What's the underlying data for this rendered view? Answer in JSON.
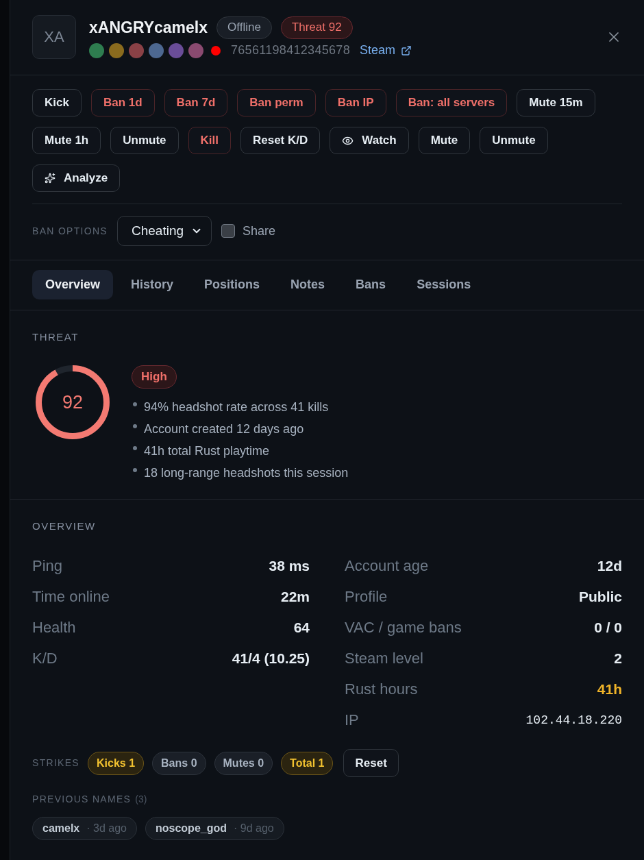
{
  "header": {
    "initials": "XA",
    "name": "xANGRYcamelx",
    "status": "Offline",
    "threat_badge": "Threat 92",
    "tags": [
      {
        "kind": "swatch",
        "color": "#2e7d4f"
      },
      {
        "kind": "swatch",
        "color": "#8a6b1e"
      },
      {
        "kind": "swatch",
        "color": "#8a4146"
      },
      {
        "kind": "swatch",
        "color": "#4d6891"
      },
      {
        "kind": "swatch",
        "color": "#6a4d98"
      },
      {
        "kind": "swatch",
        "color": "#8a4a70"
      },
      {
        "kind": "dot",
        "color": "#ff0000"
      }
    ],
    "steam_id": "76561198412345678",
    "profile_link": "Steam"
  },
  "actions": [
    {
      "label": "Kick",
      "kind": "neutral"
    },
    {
      "label": "Ban 1d",
      "kind": "danger"
    },
    {
      "label": "Ban 7d",
      "kind": "danger"
    },
    {
      "label": "Ban perm",
      "kind": "danger"
    },
    {
      "label": "Ban IP",
      "kind": "danger"
    },
    {
      "label": "Ban: all servers",
      "kind": "danger"
    },
    {
      "label": "Mute 15m",
      "kind": "neutral"
    },
    {
      "label": "Mute 1h",
      "kind": "neutral"
    },
    {
      "label": "Unmute",
      "kind": "neutral"
    },
    {
      "label": "Kill",
      "kind": "danger"
    },
    {
      "label": "Reset K/D",
      "kind": "neutral"
    },
    {
      "label": "Watch",
      "kind": "watch"
    },
    {
      "label": "Mute",
      "kind": "neutral"
    },
    {
      "label": "Unmute",
      "kind": "neutral"
    },
    {
      "label": "Analyze",
      "kind": "analyze"
    }
  ],
  "ban_options": {
    "label": "BAN OPTIONS",
    "reason": "Cheating",
    "share": {
      "label": "Share",
      "checked": false
    }
  },
  "tabs": [
    {
      "label": "Overview",
      "selected": true
    },
    {
      "label": "History",
      "selected": false
    },
    {
      "label": "Positions",
      "selected": false
    },
    {
      "label": "Notes",
      "selected": false
    },
    {
      "label": "Bans",
      "selected": false
    },
    {
      "label": "Sessions",
      "selected": false
    }
  ],
  "threat": {
    "title": "THREAT",
    "score": "92",
    "level": 0.92,
    "rating": "High",
    "reasons": [
      "94% headshot rate across 41 kills",
      "Account created 12 days ago",
      "41h total Rust playtime",
      "18 long-range headshots this session"
    ]
  },
  "overview": {
    "title": "OVERVIEW",
    "left": [
      {
        "label": "Ping",
        "value": "38 ms",
        "kind": "plain"
      },
      {
        "label": "Time online",
        "value": "22m",
        "kind": "plain"
      },
      {
        "label": "Health",
        "value": "64",
        "kind": "plain"
      },
      {
        "label": "K/D",
        "value": "41/4 (10.25)",
        "kind": "plain"
      }
    ],
    "right": [
      {
        "label": "Account age",
        "value": "12d",
        "kind": "plain"
      },
      {
        "label": "Profile",
        "value": "Public",
        "kind": "plain"
      },
      {
        "label": "VAC / game bans",
        "value": "0 / 0",
        "kind": "plain"
      },
      {
        "label": "Steam level",
        "value": "2",
        "kind": "plain"
      },
      {
        "label": "Rust hours",
        "value": "41h",
        "kind": "warning"
      },
      {
        "label": "IP",
        "value": "102.44.18.220",
        "kind": "mono"
      }
    ]
  },
  "strikes": {
    "label": "STRIKES",
    "counters": [
      {
        "label": "Kicks 1",
        "kind": "warning"
      },
      {
        "label": "Bans 0",
        "kind": "neutral"
      },
      {
        "label": "Mutes 0",
        "kind": "neutral"
      },
      {
        "label": "Total 1",
        "kind": "warning"
      }
    ],
    "reset": "Reset"
  },
  "previous_names": {
    "title": "PREVIOUS NAMES",
    "count": "(3)",
    "names": [
      {
        "name": "camelx",
        "when": "· 3d ago"
      },
      {
        "name": "noscope_god",
        "when": "· 9d ago"
      }
    ]
  }
}
